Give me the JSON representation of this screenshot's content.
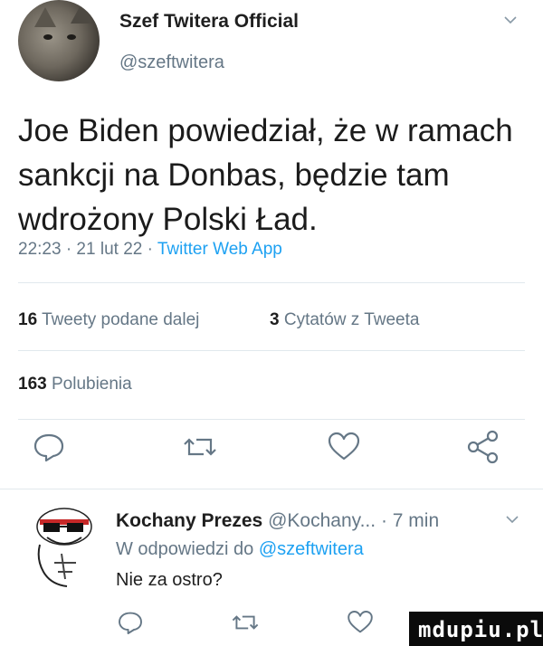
{
  "header": {
    "display_name": "Szef Twitera Official",
    "handle": "@szeftwitera"
  },
  "tweet": {
    "text": "Joe Biden powiedział, że w ramach sankcji na Donbas, będzie tam wdrożony Polski Ład.",
    "time": "22:23 · 21 lut 22 · ",
    "source": "Twitter Web App"
  },
  "stats": {
    "retweets_count": "16",
    "retweets_label": "Tweety podane dalej",
    "quotes_count": "3",
    "quotes_label": "Cytatów z Tweeta",
    "likes_count": "163",
    "likes_label": "Polubienia"
  },
  "actions": {
    "icons": [
      "comment-icon",
      "retweet-icon",
      "like-icon",
      "share-icon"
    ]
  },
  "reply": {
    "display_name": "Kochany Prezes",
    "handle": "@Kochany...",
    "time": "· 7 min",
    "replying_prefix": "W odpowiedzi do",
    "replying_to": "@szeftwitera",
    "text": "Nie za ostro?"
  },
  "watermark": {
    "text": "mdupiu.pl"
  },
  "colors": {
    "accent": "#1da1f2",
    "secondary_text": "#657786",
    "divider": "#e1e8ed"
  }
}
